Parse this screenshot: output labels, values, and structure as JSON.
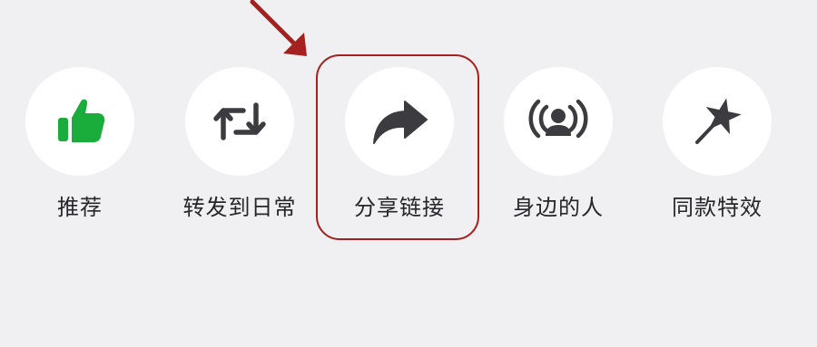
{
  "share_panel": {
    "actions": [
      {
        "label": "推荐",
        "icon": "thumbs-up-icon",
        "icon_color": "#1aad3b"
      },
      {
        "label": "转发到日常",
        "icon": "repost-icon",
        "icon_color": "#3b3b40"
      },
      {
        "label": "分享链接",
        "icon": "share-arrow-icon",
        "icon_color": "#3b3b40"
      },
      {
        "label": "身边的人",
        "icon": "nearby-people-icon",
        "icon_color": "#3b3b40"
      },
      {
        "label": "同款特效",
        "icon": "magic-wand-icon",
        "icon_color": "#3b3b40"
      }
    ]
  },
  "annotation": {
    "highlight_color": "#a5211f"
  },
  "colors": {
    "background": "#f0eff1",
    "circle": "#ffffff"
  }
}
